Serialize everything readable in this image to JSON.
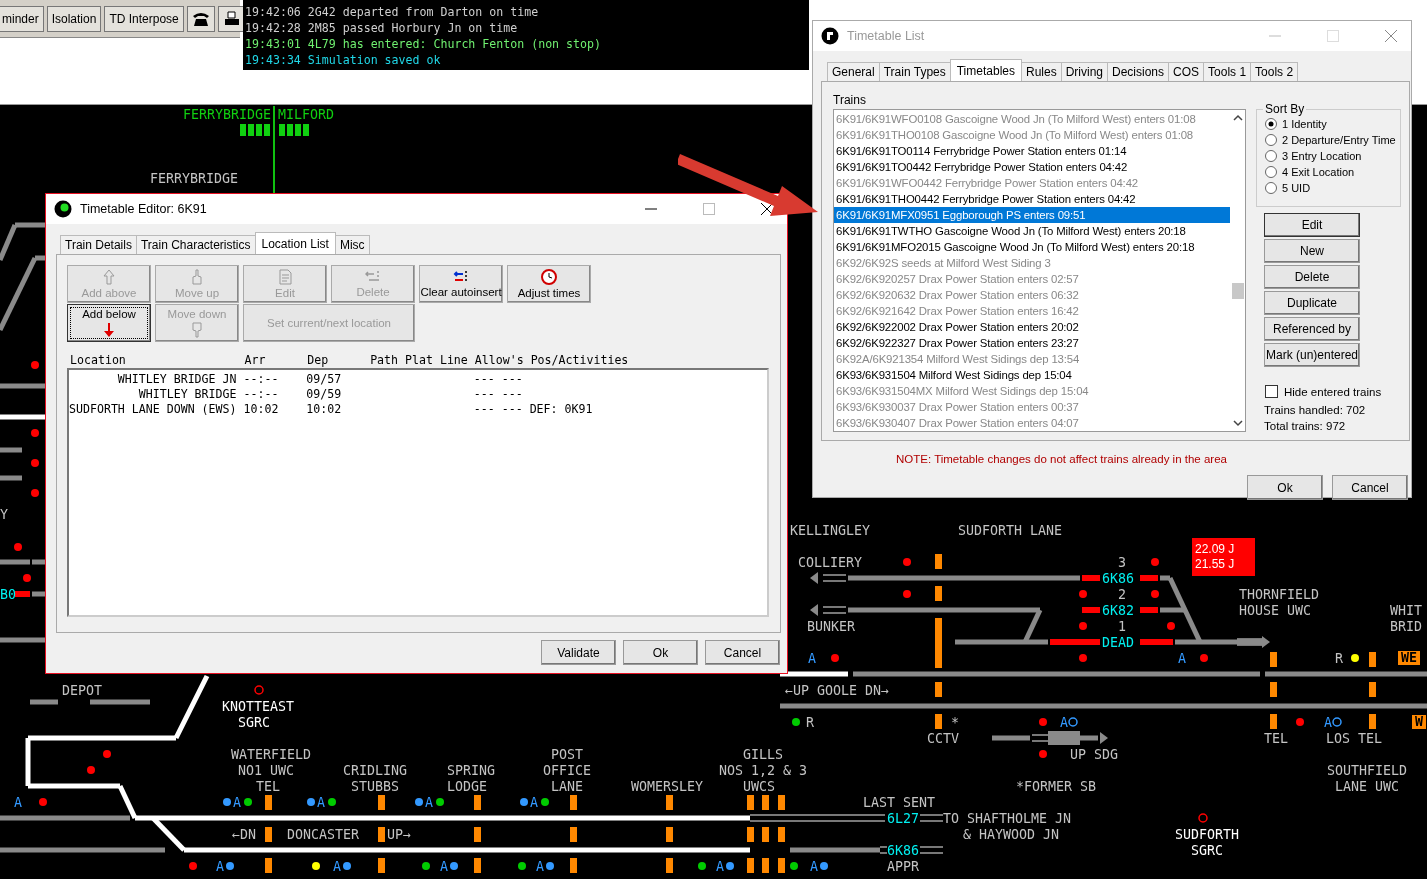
{
  "toolbar": {
    "buttons": [
      {
        "kind": "text",
        "label": "minder"
      },
      {
        "kind": "text",
        "label": "Isolation"
      },
      {
        "kind": "text",
        "label": "TD Interpose"
      },
      {
        "kind": "phone"
      },
      {
        "kind": "printer"
      }
    ]
  },
  "message_log": [
    {
      "text": "19:42:06 2G42 departed from Darton on time",
      "color": "#d0d0d0"
    },
    {
      "text": "19:42:28 2M85 passed Horbury Jn on time",
      "color": "#d0d0d0"
    },
    {
      "text": "19:43:01 4L79 has entered: Church Fenton (non stop)",
      "color": "#70f070"
    },
    {
      "text": "19:43:34 Simulation saved ok",
      "color": "#20d8e8"
    }
  ],
  "diagram": {
    "labels": [
      {
        "text": "FERRYBRIDGE",
        "kind": "area"
      },
      {
        "text": "MILFORD",
        "kind": "area"
      },
      {
        "text": "FERRYBRIDGE",
        "kind": "location"
      },
      {
        "text": "Y",
        "kind": "location"
      },
      {
        "text": "B0",
        "kind": "headcode"
      },
      {
        "text": "KELLINGLEY",
        "kind": "location"
      },
      {
        "text": "SUDFORTH LANE",
        "kind": "location"
      },
      {
        "text": "COLLIERY",
        "kind": "location"
      },
      {
        "text": "3",
        "kind": "location"
      },
      {
        "text": "6K86",
        "kind": "headcode"
      },
      {
        "text": "2",
        "kind": "location"
      },
      {
        "text": "THORNFIELD",
        "kind": "location"
      },
      {
        "text": "6K82",
        "kind": "headcode"
      },
      {
        "text": "HOUSE UWC",
        "kind": "location"
      },
      {
        "text": "WHIT",
        "kind": "location"
      },
      {
        "text": "BUNKER",
        "kind": "location"
      },
      {
        "text": "1",
        "kind": "location"
      },
      {
        "text": "BRID",
        "kind": "location"
      },
      {
        "text": "DEAD",
        "kind": "headcode"
      },
      {
        "text": "R",
        "kind": "location"
      },
      {
        "text": "WE",
        "kind": "badge"
      },
      {
        "text": "DEPOT",
        "kind": "location"
      },
      {
        "text": "←UP GOOLE DN→",
        "kind": "location"
      },
      {
        "text": "KNOTTEAST",
        "kind": "signalbox"
      },
      {
        "text": "SGRC",
        "kind": "signalbox"
      },
      {
        "text": "R",
        "kind": "location"
      },
      {
        "text": "*",
        "kind": "location"
      },
      {
        "text": "W",
        "kind": "badge"
      },
      {
        "text": "CCTV",
        "kind": "location"
      },
      {
        "text": "TEL",
        "kind": "location"
      },
      {
        "text": "LOS TEL",
        "kind": "location"
      },
      {
        "text": "WATERFIELD",
        "kind": "location"
      },
      {
        "text": "POST",
        "kind": "location"
      },
      {
        "text": "GILLS",
        "kind": "location"
      },
      {
        "text": "UP SDG",
        "kind": "location"
      },
      {
        "text": "NO1 UWC",
        "kind": "location"
      },
      {
        "text": "CRIDLING",
        "kind": "location"
      },
      {
        "text": "SPRING",
        "kind": "location"
      },
      {
        "text": "OFFICE",
        "kind": "location"
      },
      {
        "text": "NOS 1,2 & 3",
        "kind": "location"
      },
      {
        "text": "SOUTHFIELD",
        "kind": "location"
      },
      {
        "text": "TEL",
        "kind": "location"
      },
      {
        "text": "STUBBS",
        "kind": "location"
      },
      {
        "text": "LODGE",
        "kind": "location"
      },
      {
        "text": "LANE",
        "kind": "location"
      },
      {
        "text": "WOMERSLEY",
        "kind": "location"
      },
      {
        "text": "UWCS",
        "kind": "location"
      },
      {
        "text": "*FORMER SB",
        "kind": "location"
      },
      {
        "text": "LANE UWC",
        "kind": "location"
      },
      {
        "text": "LAST SENT",
        "kind": "location"
      },
      {
        "text": "6L27",
        "kind": "headcode"
      },
      {
        "text": "TO SHAFTHOLME JN",
        "kind": "location"
      },
      {
        "text": "←DN",
        "kind": "location"
      },
      {
        "text": "DONCASTER",
        "kind": "location"
      },
      {
        "text": "UP→",
        "kind": "location"
      },
      {
        "text": "& HAYWOOD JN",
        "kind": "location"
      },
      {
        "text": "SUDFORTH",
        "kind": "signalbox"
      },
      {
        "text": "6K86",
        "kind": "headcode"
      },
      {
        "text": "SGRC",
        "kind": "signalbox"
      },
      {
        "text": "APPR",
        "kind": "location"
      }
    ],
    "alarm": [
      "22.09 J",
      "21.55 J"
    ],
    "markers": [
      {
        "label": "A"
      },
      {
        "label": "A"
      },
      {
        "label": "A"
      },
      {
        "label": "A"
      },
      {
        "label": "A"
      },
      {
        "label": "A"
      },
      {
        "label": "A"
      },
      {
        "label": "A"
      },
      {
        "label": "A"
      },
      {
        "label": "A"
      },
      {
        "label": "A"
      },
      {
        "label": "A"
      },
      {
        "label": "A"
      },
      {
        "label": "A"
      },
      {
        "label": "A"
      }
    ]
  },
  "timetable_editor": {
    "title": "Timetable Editor: 6K91",
    "tabs": [
      {
        "label": "Train Details",
        "selected": false
      },
      {
        "label": "Train Characteristics",
        "selected": false
      },
      {
        "label": "Location List",
        "selected": true
      },
      {
        "label": "Misc",
        "selected": false
      }
    ],
    "buttons": [
      {
        "label": "Add above",
        "kind": "up-arrow",
        "disabled": true,
        "focused": false
      },
      {
        "label": "Move up",
        "kind": "hand-up",
        "disabled": true,
        "focused": false
      },
      {
        "label": "Edit",
        "kind": "edit",
        "disabled": true,
        "focused": false
      },
      {
        "label": "Delete",
        "kind": "delete",
        "disabled": true,
        "focused": false
      },
      {
        "label": "Clear autoinsert",
        "kind": "clear",
        "disabled": false,
        "focused": false
      },
      {
        "label": "Adjust times",
        "kind": "clock",
        "disabled": false,
        "focused": false
      },
      {
        "label": "Add below",
        "kind": "down-arrow",
        "disabled": false,
        "focused": true
      },
      {
        "label": "Move down",
        "kind": "hand-down",
        "disabled": true,
        "focused": false
      },
      {
        "label": "Set current/next location",
        "kind": "wide",
        "disabled": true,
        "focused": false
      }
    ],
    "columns": [
      "Location",
      "Arr",
      "Dep",
      "Path",
      "Plat",
      "Line",
      "Allow's",
      "Pos/Activities"
    ],
    "rows": [
      {
        "location": "WHITLEY BRIDGE JN",
        "arr": "--:--",
        "dep": "09/57",
        "allow_1": "---",
        "allow_2": "---"
      },
      {
        "location": "WHITLEY BRIDGE",
        "arr": "--:--",
        "dep": "09/59",
        "allow_1": "---",
        "allow_2": "---"
      },
      {
        "location": "SUDFORTH LANE DOWN (EWS)",
        "arr": "10:02",
        "dep": "10:02",
        "allow_1": "---",
        "allow_2": "---",
        "activities": "DEF: 0K91"
      }
    ],
    "footer_buttons": [
      "Validate",
      "Ok",
      "Cancel"
    ]
  },
  "timetable_list": {
    "title": "Timetable List",
    "tabs": [
      {
        "label": "General",
        "selected": false
      },
      {
        "label": "Train Types",
        "selected": false
      },
      {
        "label": "Timetables",
        "selected": true
      },
      {
        "label": "Rules",
        "selected": false
      },
      {
        "label": "Driving",
        "selected": false
      },
      {
        "label": "Decisions",
        "selected": false
      },
      {
        "label": "COS",
        "selected": false
      },
      {
        "label": "Tools 1",
        "selected": false
      },
      {
        "label": "Tools 2",
        "selected": false
      }
    ],
    "trains_label": "Trains",
    "trains": [
      {
        "text": "6K91/6K91WFO0108 Gascoigne Wood Jn (To Milford West) enters 01:08",
        "greyed": true,
        "selected": false
      },
      {
        "text": "6K91/6K91THO0108 Gascoigne Wood Jn (To Milford West) enters 01:08",
        "greyed": true,
        "selected": false
      },
      {
        "text": "6K91/6K91TO0114 Ferrybridge Power Station enters 01:14",
        "greyed": false,
        "selected": false
      },
      {
        "text": "6K91/6K91TO0442 Ferrybridge Power Station enters 04:42",
        "greyed": false,
        "selected": false
      },
      {
        "text": "6K91/6K91WFO0442 Ferrybridge Power Station enters 04:42",
        "greyed": true,
        "selected": false
      },
      {
        "text": "6K91/6K91THO0442 Ferrybridge Power Station enters 04:42",
        "greyed": false,
        "selected": false
      },
      {
        "text": "6K91/6K91MFX0951 Eggborough PS enters 09:51",
        "greyed": false,
        "selected": true
      },
      {
        "text": "6K91/6K91TWTHO Gascoigne Wood Jn (To Milford West) enters 20:18",
        "greyed": false,
        "selected": false
      },
      {
        "text": "6K91/6K91MFO2015 Gascoigne Wood Jn (To Milford West) enters 20:18",
        "greyed": false,
        "selected": false
      },
      {
        "text": "6K92/6K92S seeds at Milford West Siding 3",
        "greyed": true,
        "selected": false
      },
      {
        "text": "6K92/6K920257 Drax Power Station enters 02:57",
        "greyed": true,
        "selected": false
      },
      {
        "text": "6K92/6K920632 Drax Power Station enters 06:32",
        "greyed": true,
        "selected": false
      },
      {
        "text": "6K92/6K921642 Drax Power Station enters 16:42",
        "greyed": true,
        "selected": false
      },
      {
        "text": "6K92/6K922002 Drax Power Station enters 20:02",
        "greyed": false,
        "selected": false
      },
      {
        "text": "6K92/6K922327 Drax Power Station enters 23:27",
        "greyed": false,
        "selected": false
      },
      {
        "text": "6K92A/6K921354 Milford West Sidings dep 13:54",
        "greyed": true,
        "selected": false
      },
      {
        "text": "6K93/6K931504 Milford West Sidings dep 15:04",
        "greyed": false,
        "selected": false
      },
      {
        "text": "6K93/6K931504MX Milford West Sidings dep 15:04",
        "greyed": true,
        "selected": false
      },
      {
        "text": "6K93/6K930037 Drax Power Station enters 00:37",
        "greyed": true,
        "selected": false
      },
      {
        "text": "6K93/6K930407 Drax Power Station enters 04:07",
        "greyed": true,
        "selected": false
      }
    ],
    "sort_by": {
      "title": "Sort By",
      "options": [
        {
          "label": "1 Identity",
          "selected": true
        },
        {
          "label": "2 Departure/Entry Time",
          "selected": false
        },
        {
          "label": "3 Entry Location",
          "selected": false
        },
        {
          "label": "4 Exit Location",
          "selected": false
        },
        {
          "label": "5 UID",
          "selected": false
        }
      ]
    },
    "buttons": [
      "Edit",
      "New",
      "Delete",
      "Duplicate",
      "Referenced by",
      "Mark (un)entered"
    ],
    "hide_entered": {
      "label": "Hide entered trains",
      "checked": false
    },
    "trains_handled": "Trains handled: 702",
    "total_trains": "Total trains: 972",
    "note": "NOTE: Timetable changes do not affect trains already in the area",
    "footer_buttons": [
      "Ok",
      "Cancel"
    ]
  }
}
